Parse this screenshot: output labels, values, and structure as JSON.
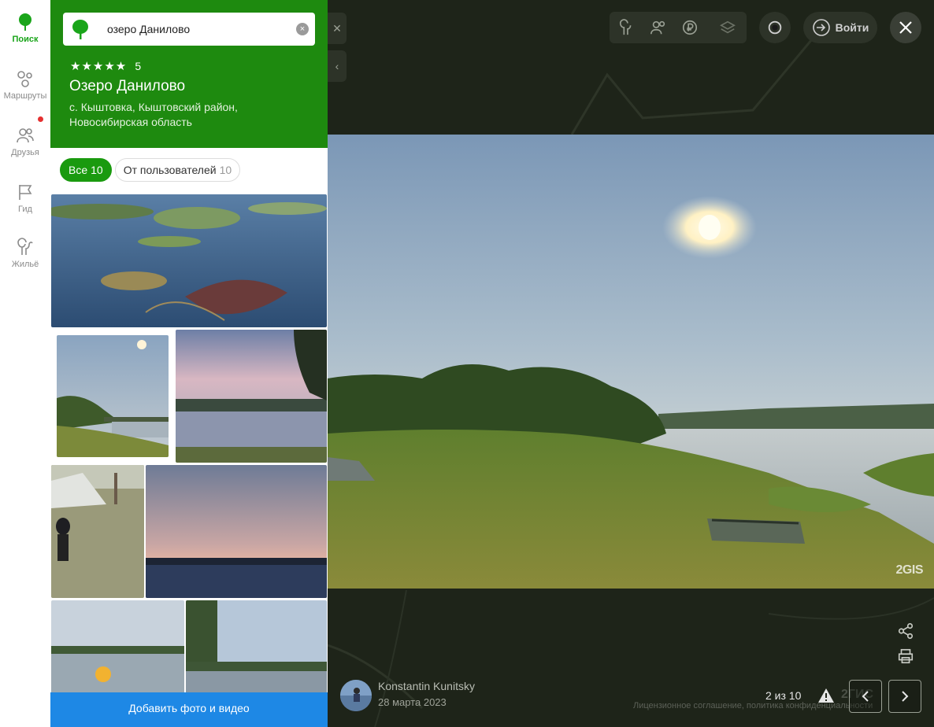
{
  "nav": {
    "items": [
      {
        "label": "Поиск",
        "icon": "leaf-icon",
        "active": true
      },
      {
        "label": "Маршруты",
        "icon": "routes-icon",
        "active": false
      },
      {
        "label": "Друзья",
        "icon": "friends-icon",
        "active": false
      },
      {
        "label": "Гид",
        "icon": "flag-icon",
        "active": false
      },
      {
        "label": "Жильё",
        "icon": "housing-icon",
        "active": false
      }
    ]
  },
  "search": {
    "value": "озеро Данилово",
    "clear_icon": "×"
  },
  "place": {
    "stars": "★★★★★",
    "rating": "5",
    "title": "Озеро Данилово",
    "address": "с. Кыштовка, Кыштовский район, Новосибирская область"
  },
  "filters": [
    {
      "label": "Все",
      "count": "10",
      "active": true
    },
    {
      "label": "От пользователей",
      "count": "10",
      "active": false
    }
  ],
  "add_button": "Добавить фото и видео",
  "toolbar": {
    "login_label": "Войти"
  },
  "viewer": {
    "watermark": "2GIS",
    "author": "Konstantin Kunitsky",
    "date": "28 марта 2023",
    "counter": "2 из 10",
    "brand": "2ГИС",
    "license": "Лицензионное соглашение, политика конфиденциальности"
  },
  "colors": {
    "header_green": "#1e8a0f",
    "accent_green": "#1a9a0f",
    "button_blue": "#1e88e5",
    "notification_red": "#e53030"
  }
}
